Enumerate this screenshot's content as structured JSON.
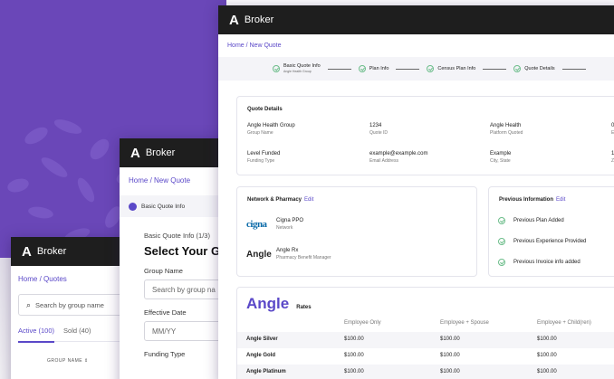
{
  "brand": {
    "logo": "A",
    "app": "Broker"
  },
  "w3": {
    "crumb": "Home / Quotes",
    "search_placeholder": "Search by group name",
    "tabs": [
      "Active (100)",
      "Sold (40)"
    ],
    "col_head": "GROUP NAME ⇕"
  },
  "w2": {
    "crumb": "Home / New Quote",
    "step": "Basic Quote Info",
    "sub": "Basic Quote Info (1/3)",
    "heading": "Select Your Gr",
    "group_label": "Group Name",
    "group_placeholder": "Search by group na",
    "date_label": "Effective Date",
    "date_placeholder": "MM/YY",
    "funding_label": "Funding Type"
  },
  "w1": {
    "crumb": "Home / New Quote",
    "steps": [
      {
        "label": "Basic Quote Info",
        "sub": "Angle Health Group"
      },
      {
        "label": "Plan Info"
      },
      {
        "label": "Census Plan Info"
      },
      {
        "label": "Quote Details"
      }
    ],
    "quote_details": {
      "title": "Quote Details",
      "cells": [
        {
          "value": "Angle Health Group",
          "label": "Group Name"
        },
        {
          "value": "1234",
          "label": "Quote ID"
        },
        {
          "value": "Angle Health",
          "label": "Platform Quoted"
        },
        {
          "value": "0",
          "label": "E"
        },
        {
          "value": "Level Funded",
          "label": "Funding Type"
        },
        {
          "value": "example@example.com",
          "label": "Email Address"
        },
        {
          "value": "Example",
          "label": "City, State"
        },
        {
          "value": "1",
          "label": "Z"
        }
      ]
    },
    "network": {
      "title": "Network & Pharmacy",
      "edit": "Edit",
      "rows": [
        {
          "logo": "cigna",
          "name": "Cigna PPO",
          "sub": "Network"
        },
        {
          "logo": "Angle",
          "name": "Angle Rx",
          "sub": "Pharmacy Benefit Manager"
        }
      ]
    },
    "previous": {
      "title": "Previous Information",
      "edit": "Edit",
      "items": [
        "Previous Plan Added",
        "Previous Experience Provided",
        "Previous Invoice info added"
      ]
    },
    "rates": {
      "brand": "Angle",
      "label": "Rates",
      "headers": [
        "Employee Only",
        "Employee + Spouse",
        "Employee + Child(ren)"
      ],
      "rows": [
        {
          "name": "Angle Silver",
          "values": [
            "$100.00",
            "$100.00",
            "$100.00"
          ]
        },
        {
          "name": "Angle Gold",
          "values": [
            "$100.00",
            "$100.00",
            "$100.00"
          ]
        },
        {
          "name": "Angle Platinum",
          "values": [
            "$100.00",
            "$100.00",
            "$100.00"
          ]
        }
      ]
    }
  }
}
